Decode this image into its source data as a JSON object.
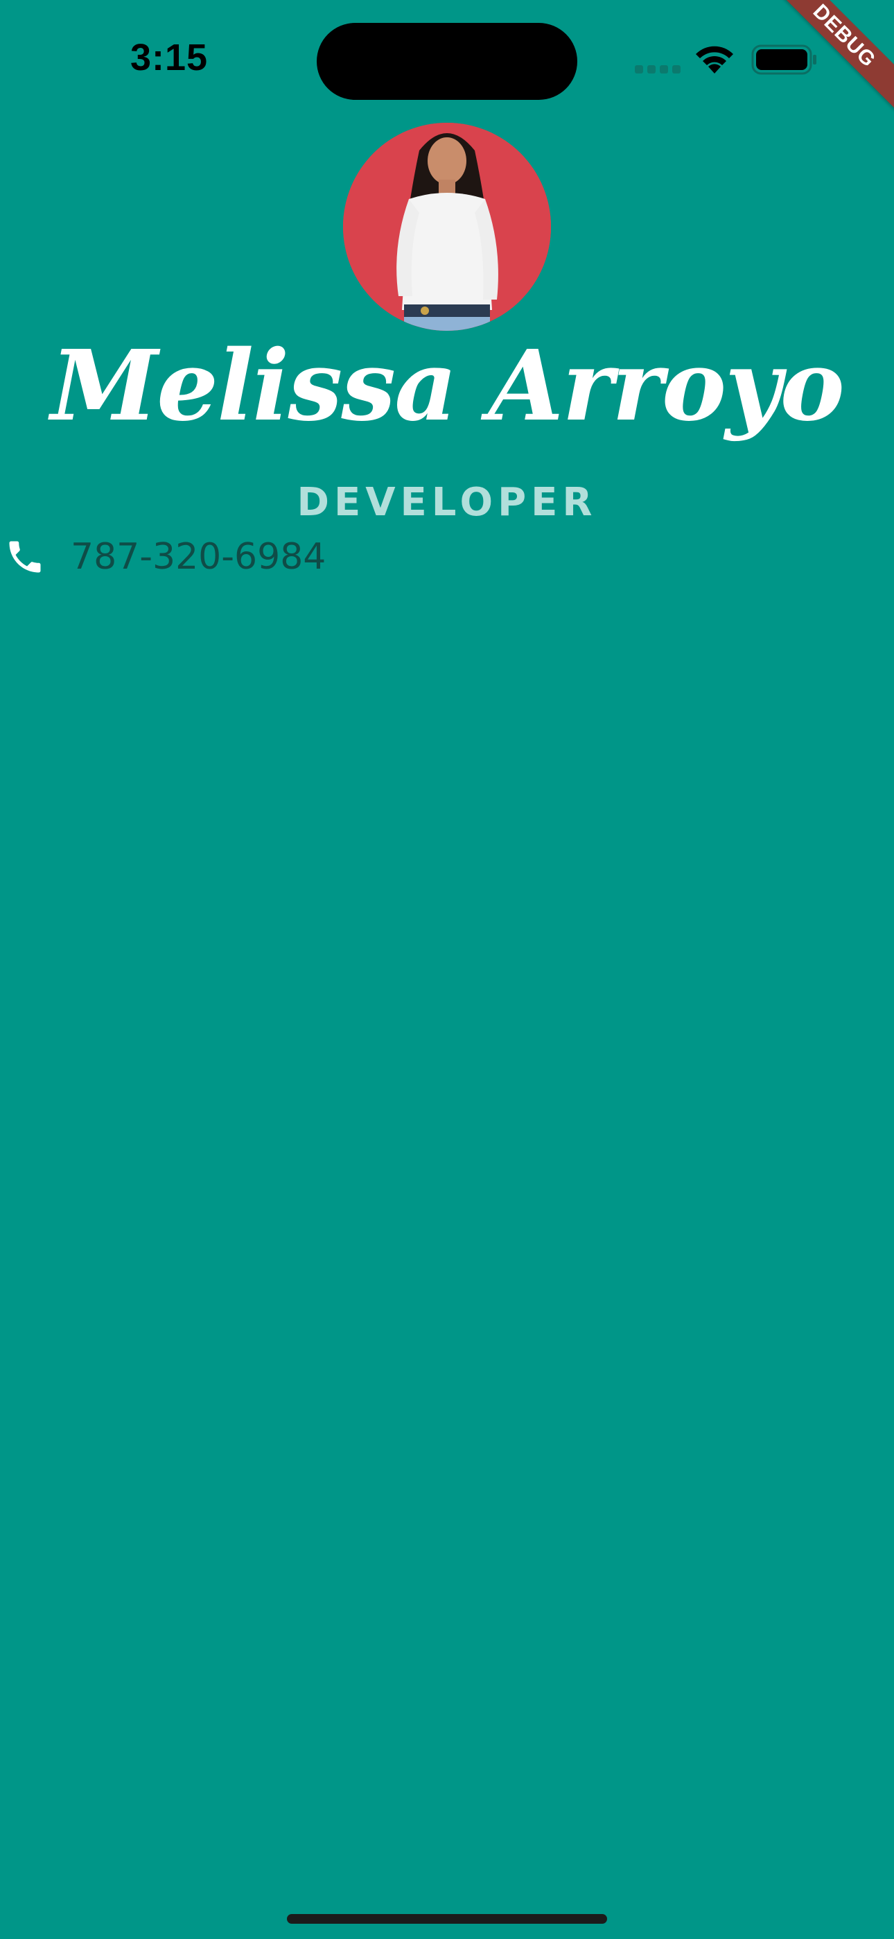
{
  "status_bar": {
    "time": "3:15"
  },
  "debug_banner": {
    "label": "DEBUG"
  },
  "profile": {
    "name": "Melissa Arroyo",
    "title": "DEVELOPER",
    "phone": "787-320-6984"
  },
  "icons": {
    "signal": "signal-icon",
    "wifi": "wifi-icon",
    "battery": "battery-icon",
    "phone": "phone-icon"
  },
  "colors": {
    "background": "#009688",
    "title_text": "#b2dfdb",
    "phone_text": "#0f4c47",
    "debug_banner": "#8e3b33"
  }
}
